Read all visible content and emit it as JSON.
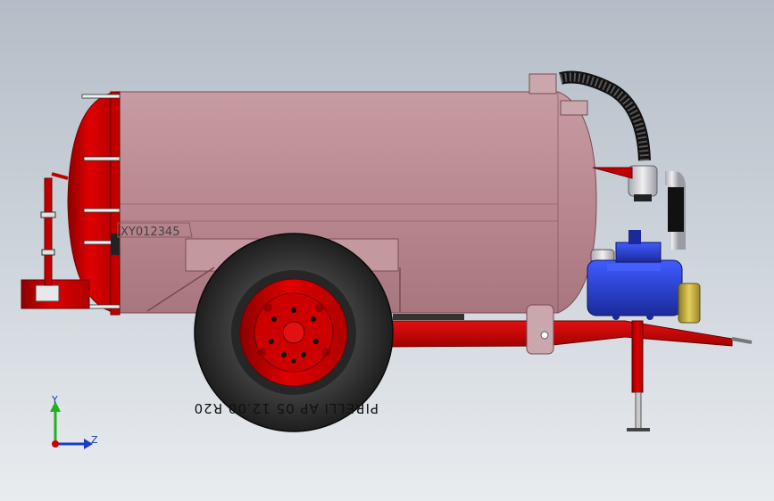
{
  "model": {
    "tank_serial": "XY012345",
    "tire_label": "PIRELLI AP 05   12.00 R20"
  },
  "axes": {
    "y_label": "Y",
    "z_label": "Z"
  },
  "colors": {
    "background_top": "#b4bdc7",
    "background_bottom": "#e9ecef",
    "tank": "#c08c94",
    "red": "#d00000",
    "tire": "#303030",
    "pump_blue": "#2a3fd8",
    "pipe": "#d8d8dc",
    "hose": "#1a1a1a",
    "motor_pulley": "#d2b83c"
  },
  "icons": [
    "axis-triad-icon"
  ]
}
